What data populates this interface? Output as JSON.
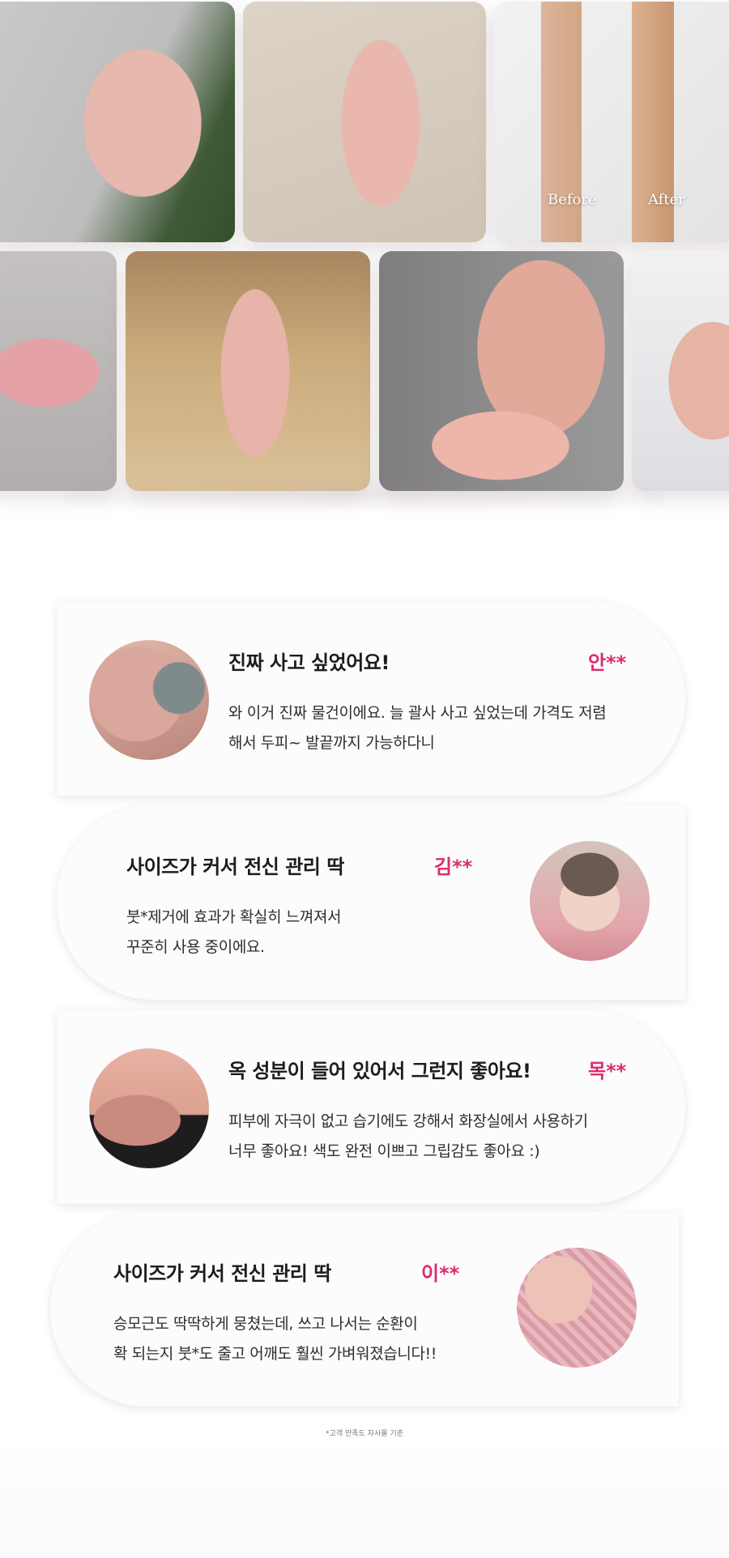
{
  "gallery": {
    "photos": [
      {
        "name": "photo-arm-massage",
        "colors": [
          "#c9c9c9",
          "#e7b8ae",
          "#3f5a36"
        ]
      },
      {
        "name": "photo-tool-in-hand",
        "colors": [
          "#d8cfc2",
          "#e9b7ae",
          "#d99a91"
        ]
      },
      {
        "name": "photo-legs-before-after",
        "colors": [
          "#eeeeee",
          "#ddb59b",
          "#c9956f"
        ],
        "before_label": "Before",
        "after_label": "After"
      },
      {
        "name": "photo-tool-closeup",
        "colors": [
          "#bfbcbc",
          "#e4a2a7",
          "#c46a74"
        ]
      },
      {
        "name": "photo-tool-wood-table",
        "colors": [
          "#c9a97a",
          "#e8b3a9",
          "#d69a8e"
        ]
      },
      {
        "name": "photo-face-massage",
        "colors": [
          "#8b8b8b",
          "#e2a99a",
          "#f0b7ae"
        ]
      },
      {
        "name": "photo-shoulder-massage",
        "colors": [
          "#e9e9eb",
          "#e7b3a4",
          "#d59686"
        ]
      }
    ]
  },
  "reviews": [
    {
      "title": "진짜 사고 싶었어요!",
      "author": "안**",
      "lines": [
        "와 이거 진짜 물건이에요. 늘 괄사 사고 싶었는데 가격도 저렴",
        "해서  두피~ 발끝까지 가능하다니"
      ],
      "avatar_colors": [
        "#d9a79b",
        "#b98579",
        "#7f8a8c"
      ]
    },
    {
      "title": "사이즈가 커서 전신 관리 딱",
      "author": "김**",
      "lines": [
        "붓*제거에 효과가 확실히 느껴져서",
        "꾸준히 사용 중이에요."
      ],
      "avatar_colors": [
        "#f0d2c6",
        "#e3a6ab",
        "#6b5a52"
      ]
    },
    {
      "title": "옥 성분이 들어 있어서 그런지 좋아요!",
      "author": "목**",
      "lines": [
        "피부에 자극이 없고 습기에도 강해서 화장실에서 사용하기",
        "너무 좋아요! 색도 완전 이쁘고 그립감도 좋아요 :)"
      ],
      "avatar_colors": [
        "#e8b1a3",
        "#c98a80",
        "#1e1c1c"
      ]
    },
    {
      "title": "사이즈가 커서 전신 관리 딱",
      "author": "이**",
      "lines": [
        "승모근도 딱딱하게 뭉쳤는데, 쓰고 나서는 순환이",
        "확 되는지 붓*도 줄고 어깨도 훨씬 가벼워졌습니다!!"
      ],
      "avatar_colors": [
        "#ecc3b6",
        "#d99aa4",
        "#c58d83"
      ]
    }
  ],
  "footnote": "*고객 만족도 자사몰 기준",
  "colors": {
    "author": "#d92d6f",
    "card_bg": "#fcfcfc"
  }
}
